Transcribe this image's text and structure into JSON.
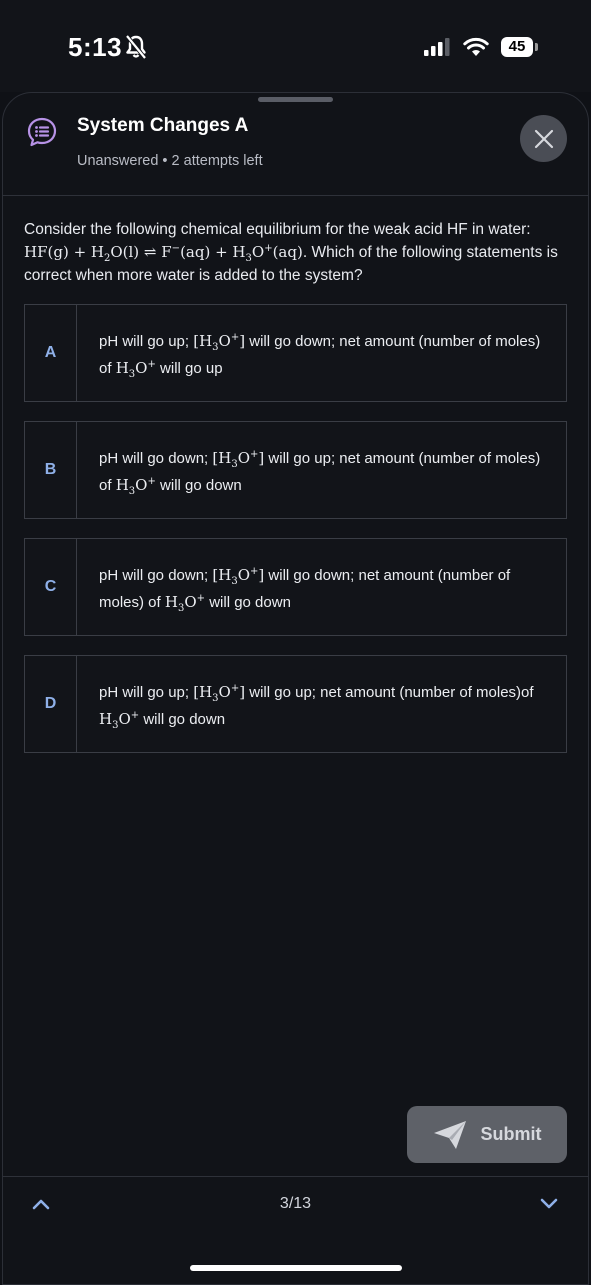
{
  "status": {
    "time": "5:13",
    "battery": "45"
  },
  "header": {
    "title": "System Changes A",
    "subtitle": "Unanswered • 2 attempts left"
  },
  "question": {
    "intro": "Consider the following chemical equilibrium for the weak acid HF in water: ",
    "outro": ". Which of the following statements is correct when more water is added to the system?"
  },
  "options": [
    {
      "letter": "A",
      "p1": "pH will go up; ",
      "p2": " will go down;  net amount (number of moles) of ",
      "p3": " will go up"
    },
    {
      "letter": "B",
      "p1": "pH will go down; ",
      "p2": " will go up;  net amount (number of moles) of ",
      "p3": " will go down"
    },
    {
      "letter": "C",
      "p1": "pH will go down; ",
      "p2": " will go down;  net amount (number of moles) of ",
      "p3": " will go down"
    },
    {
      "letter": "D",
      "p1": "pH will go up; ",
      "p2": " will go up;  net amount  (number of moles)of ",
      "p3": " will go down"
    }
  ],
  "submit": {
    "label": "Submit"
  },
  "footer": {
    "page": "3/13"
  },
  "colors": {
    "accent": "#8fb0e8",
    "background": "#0f1116",
    "chat_icon": "#b792e6"
  },
  "icons": {
    "header": "chat-bubble-list-icon",
    "close": "close-icon",
    "submit": "send-plane-icon",
    "prev": "chevron-up-icon",
    "next": "chevron-down-icon"
  }
}
